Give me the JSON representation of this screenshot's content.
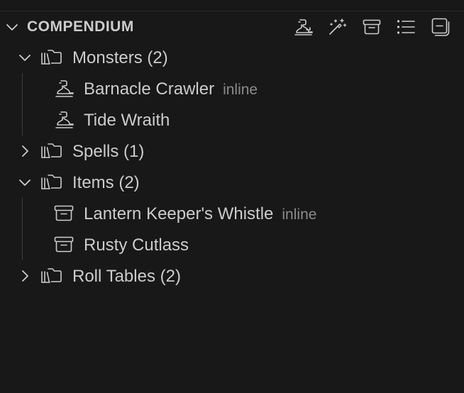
{
  "section": {
    "title": "COMPENDIUM",
    "actions": [
      {
        "name": "add-monster",
        "icon": "monster-icon"
      },
      {
        "name": "add-spell",
        "icon": "magic-wand-icon"
      },
      {
        "name": "add-item",
        "icon": "archive-box-icon"
      },
      {
        "name": "add-roll-table",
        "icon": "list-icon"
      },
      {
        "name": "collapse-all",
        "icon": "collapse-all-icon"
      }
    ]
  },
  "tree": {
    "monsters": {
      "label": "Monsters (2)",
      "expanded": true,
      "children": [
        {
          "label": "Barnacle Crawler",
          "description": "inline",
          "icon": "monster-icon"
        },
        {
          "label": "Tide Wraith",
          "description": "",
          "icon": "monster-icon"
        }
      ]
    },
    "spells": {
      "label": "Spells (1)",
      "expanded": false
    },
    "items": {
      "label": "Items (2)",
      "expanded": true,
      "children": [
        {
          "label": "Lantern Keeper's Whistle",
          "description": "inline",
          "icon": "archive-box-icon"
        },
        {
          "label": "Rusty Cutlass",
          "description": "",
          "icon": "archive-box-icon"
        }
      ]
    },
    "roll_tables": {
      "label": "Roll Tables (2)",
      "expanded": false
    }
  },
  "colors": {
    "background": "#181818",
    "foreground": "#cccccc",
    "description": "#8b8b8b",
    "indent_guide": "#3e3e3e"
  }
}
